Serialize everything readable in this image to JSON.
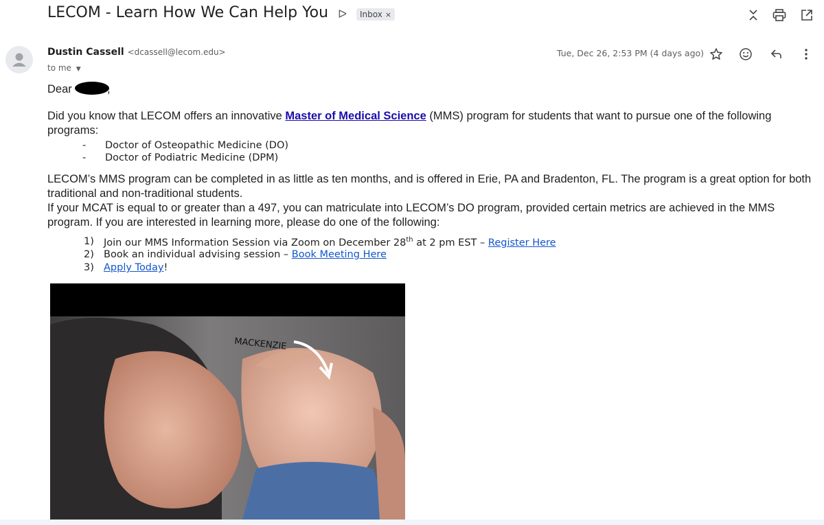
{
  "email": {
    "subject": "LECOM - Learn How We Can Help You",
    "label": "Inbox",
    "label_close": "×",
    "sender_name": "Dustin Cassell",
    "sender_email": "<dcassell@lecom.edu>",
    "to": "to me",
    "date": "Tue, Dec 26, 2:53 PM (4 days ago)"
  },
  "body": {
    "greeting": "Dear",
    "greeting_comma": ",",
    "p1_before": "Did you know that LECOM offers an innovative ",
    "p1_link": "Master of Medical Science",
    "p1_after": " (MMS) program for students that want to pursue one of the following programs:",
    "bullets": [
      {
        "marker": "-",
        "text": "Doctor of Osteopathic Medicine (DO)"
      },
      {
        "marker": "-",
        "text": "Doctor of Podiatric Medicine (DPM)"
      }
    ],
    "p2": "LECOM’s MMS program can be completed in as little as ten months, and is offered in Erie, PA and Bradenton, FL. The program is a great option for both traditional and non-traditional students.",
    "p3": "If your MCAT is equal to or greater than a 497, you can matriculate into LECOM’s DO program, provided certain metrics are achieved in the MMS program. If you are interested in learning more, please do one of the following:",
    "steps": [
      {
        "num": "1)",
        "text": "Join our MMS Information Session via Zoom on December 28",
        "sup": "th",
        "text2": " at 2 pm EST – ",
        "link": "Register Here"
      },
      {
        "num": "2)",
        "text": "Book an individual advising session – ",
        "link": "Book Meeting Here"
      },
      {
        "num": "3)",
        "link": "Apply Today",
        "after": "!"
      }
    ],
    "image_caption": "MACKENZIE"
  },
  "icons": {
    "importance": "importance-marker-icon",
    "expand": "expand-collapse-icon",
    "print": "print-icon",
    "popout": "open-new-window-icon",
    "star": "star-icon",
    "emoji": "emoji-react-icon",
    "reply": "reply-icon",
    "more": "more-vert-icon"
  }
}
